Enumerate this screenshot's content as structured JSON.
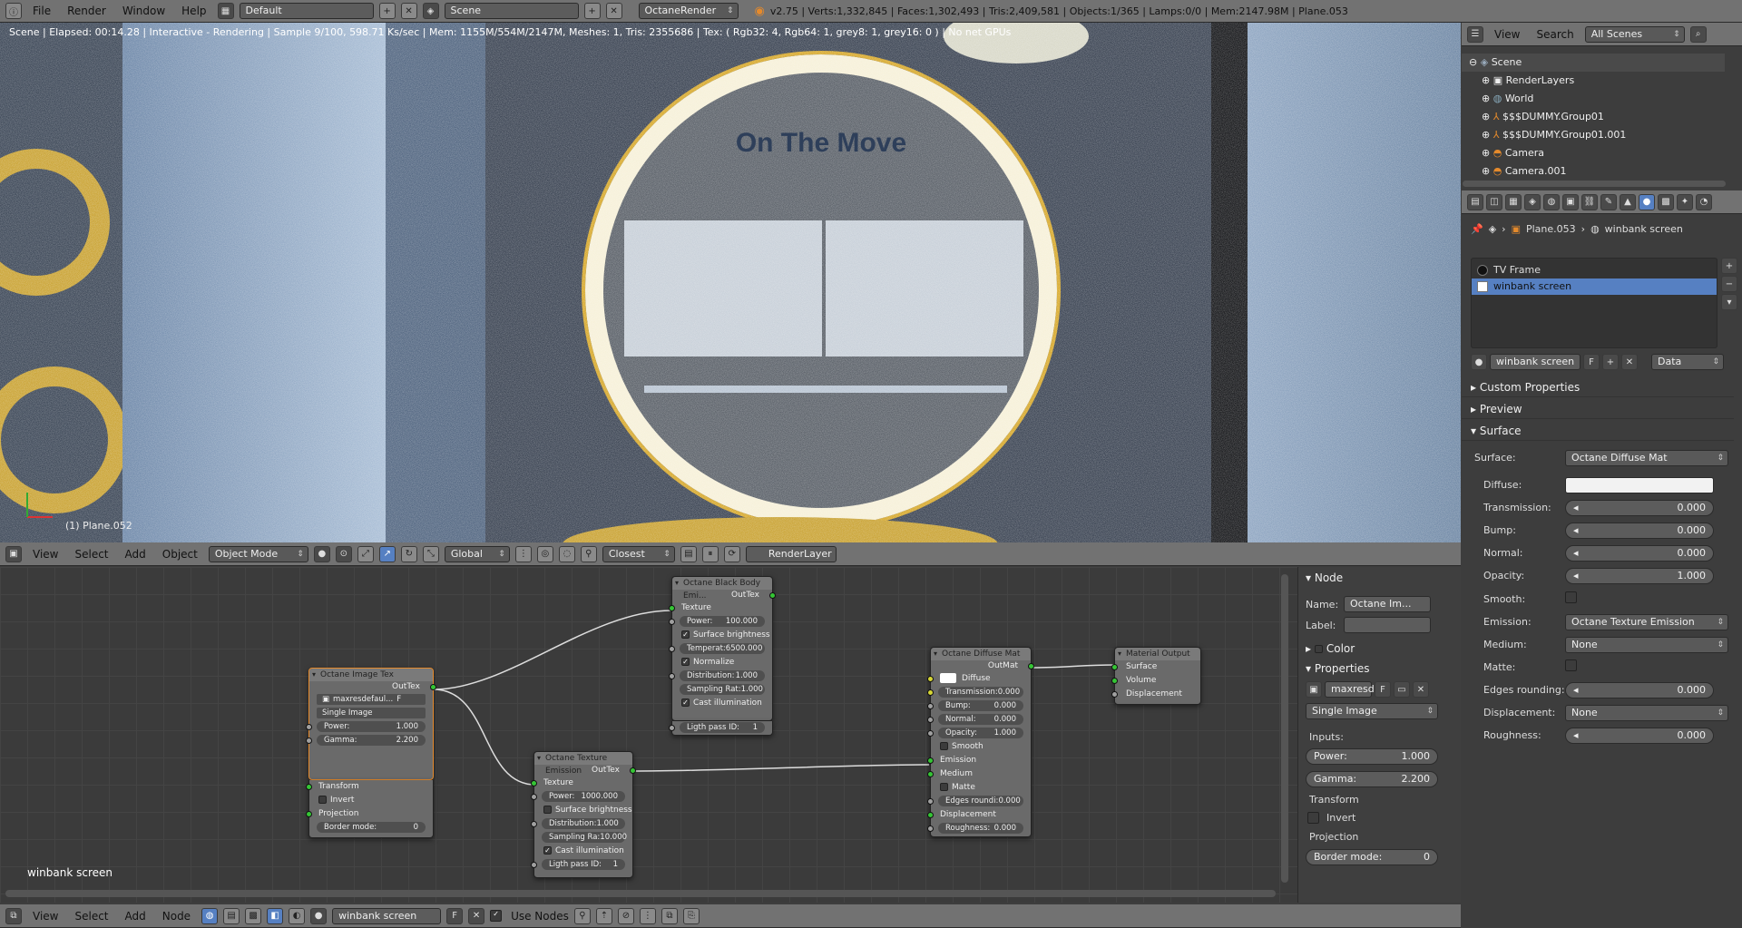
{
  "topbar": {
    "menus": [
      "File",
      "Render",
      "Window",
      "Help"
    ],
    "layout": "Default",
    "scene": "Scene",
    "engine": "OctaneRender",
    "stats": "v2.75 | Verts:1,332,845 | Faces:1,302,493 | Tris:2,409,581 | Objects:1/365 | Lamps:0/0 | Mem:2147.98M | Plane.053"
  },
  "viewport": {
    "status": "Scene | Elapsed: 00:14.28 | Interactive - Rendering | Sample 9/100, 598.71 Ks/sec | Mem: 1155M/554M/2147M, Meshes: 1, Tris: 2355686 | Tex: ( Rgb32: 4, Rgb64: 1, grey8: 1, grey16: 0 ) | No net GPUs",
    "object_label": "(1) Plane.052",
    "sign_text": "On The Move"
  },
  "vp_header": {
    "menus": [
      "View",
      "Select",
      "Add",
      "Object"
    ],
    "mode": "Object Mode",
    "orientation": "Global",
    "snap": "Closest",
    "render_layer": "RenderLayer"
  },
  "nodes": {
    "image_tex": {
      "title": "Octane Image Tex",
      "out": "OutTex",
      "file": "maxresdefaul...",
      "file_f": "F",
      "proj_mode": "Single Image",
      "power_l": "Power:",
      "power": "1.000",
      "gamma_l": "Gamma:",
      "gamma": "2.200",
      "transform": "Transform",
      "invert": "Invert",
      "projection": "Projection",
      "border_l": "Border mode:",
      "border": "0"
    },
    "black_body": {
      "title": "Octane Black Body Emi...",
      "out": "OutTex",
      "texture": "Texture",
      "power_l": "Power:",
      "power": "100.000",
      "surf": "Surface brightness",
      "temp_l": "Temperat:",
      "temp": "6500.000",
      "normalize": "Normalize",
      "dist_l": "Distribution:",
      "dist": "1.000",
      "samp_l": "Sampling Rat:",
      "samp": "1.000",
      "cast": "Cast illumination",
      "pass_l": "Ligth pass ID:",
      "pass": "1"
    },
    "tex_emission": {
      "title": "Octane Texture Emission",
      "out": "OutTex",
      "texture": "Texture",
      "power_l": "Power:",
      "power": "1000.000",
      "surf": "Surface brightness",
      "dist_l": "Distribution:",
      "dist": "1.000",
      "samp_l": "Sampling Ra:",
      "samp": "10.000",
      "cast": "Cast illumination",
      "pass_l": "Ligth pass ID:",
      "pass": "1"
    },
    "diffuse": {
      "title": "Octane Diffuse Mat",
      "out": "OutMat",
      "diffuse": "Diffuse",
      "trans_l": "Transmission:",
      "trans": "0.000",
      "bump_l": "Bump:",
      "bump": "0.000",
      "normal_l": "Normal:",
      "normal": "0.000",
      "opac_l": "Opacity:",
      "opac": "1.000",
      "smooth": "Smooth",
      "emission": "Emission",
      "medium": "Medium",
      "matte": "Matte",
      "edges_l": "Edges roundi:",
      "edges": "0.000",
      "disp": "Displacement",
      "rough_l": "Roughness:",
      "rough": "0.000"
    },
    "output": {
      "title": "Material Output",
      "surface": "Surface",
      "volume": "Volume",
      "displacement": "Displacement"
    },
    "material_label": "winbank screen"
  },
  "node_panel": {
    "node_h": "Node",
    "name_l": "Name:",
    "name": "Octane Im...",
    "label_l": "Label:",
    "color_h": "Color",
    "props_h": "Properties",
    "file": "maxresd",
    "file_f": "F",
    "proj_mode": "Single Image",
    "inputs_l": "Inputs:",
    "power_l": "Power:",
    "power": "1.000",
    "gamma_l": "Gamma:",
    "gamma": "2.200",
    "transform": "Transform",
    "invert": "Invert",
    "projection": "Projection",
    "border_l": "Border mode:",
    "border": "0"
  },
  "ne_header": {
    "menus": [
      "View",
      "Select",
      "Add",
      "Node"
    ],
    "material": "winbank screen",
    "mat_f": "F",
    "use_nodes": "Use Nodes"
  },
  "outliner": {
    "menus": [
      "View",
      "Search"
    ],
    "filter": "All Scenes",
    "rows": [
      "Scene",
      "RenderLayers",
      "World",
      "$$$DUMMY.Group01",
      "$$$DUMMY.Group01.001",
      "Camera",
      "Camera.001"
    ]
  },
  "props": {
    "object": "Plane.053",
    "material": "winbank screen",
    "slots": [
      "TV Frame",
      "winbank screen"
    ],
    "mat_field": "winbank screen",
    "mat_f": "F",
    "link": "Data",
    "sections": [
      "Custom Properties",
      "Preview",
      "Surface"
    ],
    "surface_l": "Surface:",
    "surface": "Octane Diffuse Mat",
    "diffuse_l": "Diffuse:",
    "trans_l": "Transmission:",
    "trans": "0.000",
    "bump_l": "Bump:",
    "bump": "0.000",
    "normal_l": "Normal:",
    "normal": "0.000",
    "opac_l": "Opacity:",
    "opac": "1.000",
    "smooth_l": "Smooth:",
    "emission_l": "Emission:",
    "emission": "Octane Texture Emission",
    "medium_l": "Medium:",
    "medium": "None",
    "matte_l": "Matte:",
    "edges_l": "Edges rounding:",
    "edges": "0.000",
    "disp_l": "Displacement:",
    "disp": "None",
    "rough_l": "Roughness:",
    "rough": "0.000"
  }
}
